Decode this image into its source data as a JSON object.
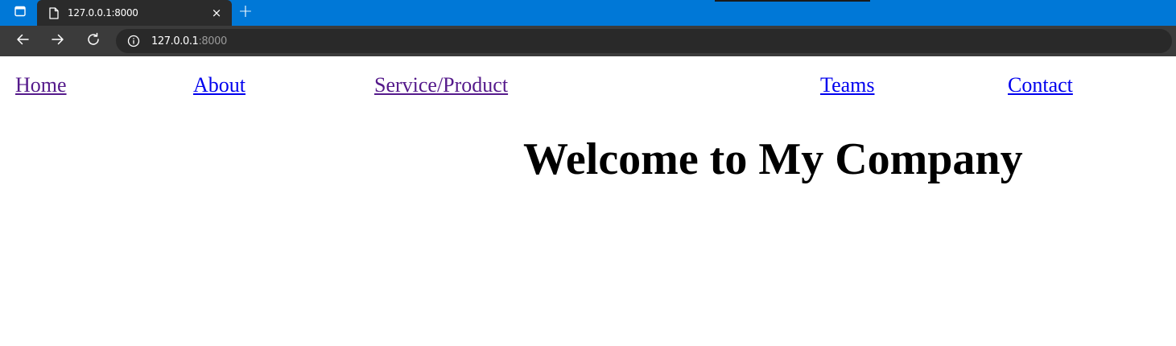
{
  "browser": {
    "tab": {
      "title": "127.0.0.1:8000",
      "close_glyph": "×",
      "icon": "document-icon"
    },
    "new_tab_glyph": "+",
    "toolbar": {
      "url_host": "127.0.0.1",
      "url_port": ":8000",
      "icons": [
        "back-arrow-icon",
        "forward-arrow-icon",
        "reload-icon",
        "info-icon"
      ]
    },
    "colors": {
      "tabstrip": "#0078d7",
      "tab": "#2b2b2b",
      "toolbar": "#3b3b3b",
      "omnibox": "#292929"
    }
  },
  "page": {
    "nav": [
      {
        "label": "Home",
        "state": "visited"
      },
      {
        "label": "About",
        "state": "unvisited"
      },
      {
        "label": "Service/Product",
        "state": "visited"
      },
      {
        "label": "Teams",
        "state": "unvisited"
      },
      {
        "label": "Contact",
        "state": "unvisited"
      }
    ],
    "heading": "Welcome to My Company",
    "colors": {
      "visited_link": "#551a8b",
      "unvisited_link": "#0000ee",
      "heading": "#000000"
    }
  }
}
